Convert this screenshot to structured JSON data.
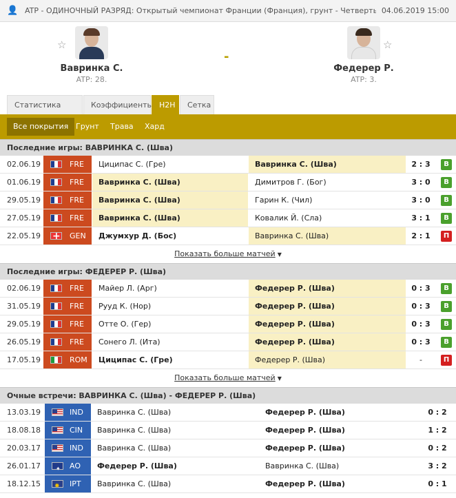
{
  "header": {
    "title": "ATP - ОДИНОЧНЫЙ РАЗРЯД: Открытый чемпионат Франции (Франция), грунт - Четвертьфиналы",
    "datetime": "04.06.2019 15:00"
  },
  "players": {
    "left": {
      "name": "Вавринка С.",
      "rank": "ATP: 28."
    },
    "right": {
      "name": "Федерер Р.",
      "rank": "ATP: 3."
    },
    "separator": "-"
  },
  "tabs": [
    "Статистика матча",
    "Коэффициенты",
    "H2H",
    "Сетка"
  ],
  "active_tab": "H2H",
  "filters": [
    "Все покрытия",
    "Грунт",
    "Трава",
    "Хард"
  ],
  "show_more": "Показать больше матчей",
  "sections": [
    {
      "title": "Последние игры: ВАВРИНКА С. (Шва)",
      "rows": [
        {
          "date": "02.06.19",
          "tour": "FRE",
          "p1": "Циципас С. (Гре)",
          "p2": "Вавринка С. (Шва)",
          "score": "2 : 3",
          "result": "В"
        },
        {
          "date": "01.06.19",
          "tour": "FRE",
          "p1": "Вавринка С. (Шва)",
          "p2": "Димитров Г. (Бог)",
          "score": "3 : 0",
          "result": "В"
        },
        {
          "date": "29.05.19",
          "tour": "FRE",
          "p1": "Вавринка С. (Шва)",
          "p2": "Гарин К. (Чил)",
          "score": "3 : 0",
          "result": "В"
        },
        {
          "date": "27.05.19",
          "tour": "FRE",
          "p1": "Вавринка С. (Шва)",
          "p2": "Ковалик Й. (Сла)",
          "score": "3 : 1",
          "result": "В"
        },
        {
          "date": "22.05.19",
          "tour": "GEN",
          "p1": "Джумхур Д. (Бос)",
          "p2": "Вавринка С. (Шва)",
          "score": "2 : 1",
          "result": "П"
        }
      ]
    },
    {
      "title": "Последние игры: ФЕДЕРЕР Р. (Шва)",
      "rows": [
        {
          "date": "02.06.19",
          "tour": "FRE",
          "p1": "Майер Л. (Арг)",
          "p2": "Федерер Р. (Шва)",
          "score": "0 : 3",
          "result": "В"
        },
        {
          "date": "31.05.19",
          "tour": "FRE",
          "p1": "Рууд К. (Нор)",
          "p2": "Федерер Р. (Шва)",
          "score": "0 : 3",
          "result": "В"
        },
        {
          "date": "29.05.19",
          "tour": "FRE",
          "p1": "Отте О. (Гер)",
          "p2": "Федерер Р. (Шва)",
          "score": "0 : 3",
          "result": "В"
        },
        {
          "date": "26.05.19",
          "tour": "FRE",
          "p1": "Сонего Л. (Ита)",
          "p2": "Федерер Р. (Шва)",
          "score": "0 : 3",
          "result": "В"
        },
        {
          "date": "17.05.19",
          "tour": "ROM",
          "p1": "Циципас С. (Гре)",
          "p2": "Федерер Р. (Шва)",
          "score": "-",
          "result": "П"
        }
      ]
    }
  ],
  "h2h": {
    "title": "Очные встречи: ВАВРИНКА С. (Шва) - ФЕДЕРЕР Р. (Шва)",
    "rows": [
      {
        "date": "13.03.19",
        "tour": "IND",
        "p1": "Вавринка С. (Шва)",
        "p2": "Федерер Р. (Шва)",
        "score": "0 : 2"
      },
      {
        "date": "18.08.18",
        "tour": "CIN",
        "p1": "Вавринка С. (Шва)",
        "p2": "Федерер Р. (Шва)",
        "score": "1 : 2"
      },
      {
        "date": "20.03.17",
        "tour": "IND",
        "p1": "Вавринка С. (Шва)",
        "p2": "Федерер Р. (Шва)",
        "score": "0 : 2"
      },
      {
        "date": "26.01.17",
        "tour": "AO",
        "p1": "Федерер Р. (Шва)",
        "p2": "Вавринка С. (Шва)",
        "score": "3 : 2"
      },
      {
        "date": "18.12.15",
        "tour": "IPT",
        "p1": "Вавринка С. (Шва)",
        "p2": "Федерер Р. (Шва)",
        "score": "0 : 1"
      }
    ]
  }
}
